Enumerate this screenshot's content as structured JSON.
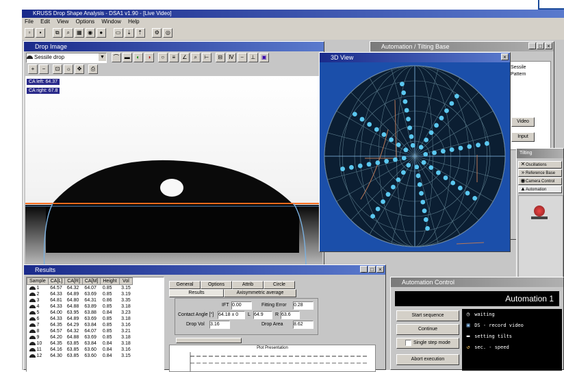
{
  "app": {
    "title": "KRUSS Drop Shape Analysis - DSA1 v1.90 - [Live Video]",
    "menu": [
      "File",
      "Edit",
      "View",
      "Options",
      "Window",
      "Help"
    ]
  },
  "image_window": {
    "title": "Drop Image",
    "method": "Sessile drop",
    "angle_left": "CA left: 64.37",
    "angle_right": "CA right: 67.8"
  },
  "polar_window": {
    "title": "3D View"
  },
  "right_window": {
    "title": "Automation / Tilting Base",
    "items": [
      "Oscillations",
      "Reference Base",
      "Camera Control",
      "Automation"
    ],
    "side_texts": [
      "Sessile",
      "Pattern",
      "Video",
      "Input"
    ]
  },
  "results_window": {
    "title": "Results",
    "columns": [
      "Sample",
      "CA[L]",
      "CA[R]",
      "CA[M]",
      "Height",
      "Vol"
    ],
    "rows": [
      [
        "1",
        "64.57",
        "64.32",
        "64.07",
        "0.85",
        "3.15"
      ],
      [
        "2",
        "64.33",
        "64.89",
        "63.69",
        "0.85",
        "3.19"
      ],
      [
        "3",
        "64.81",
        "64.80",
        "64.31",
        "0.86",
        "3.35"
      ],
      [
        "4",
        "64.33",
        "64.88",
        "63.89",
        "0.85",
        "3.18"
      ],
      [
        "5",
        "64.00",
        "63.95",
        "63.88",
        "0.84",
        "3.23"
      ],
      [
        "6",
        "64.33",
        "64.89",
        "63.69",
        "0.85",
        "3.18"
      ],
      [
        "7",
        "64.35",
        "64.29",
        "63.84",
        "0.85",
        "3.16"
      ],
      [
        "8",
        "64.57",
        "64.32",
        "64.07",
        "0.85",
        "3.21"
      ],
      [
        "9",
        "64.20",
        "64.88",
        "63.69",
        "0.85",
        "3.18"
      ],
      [
        "10",
        "64.35",
        "63.85",
        "63.84",
        "0.84",
        "3.18"
      ],
      [
        "11",
        "64.16",
        "63.85",
        "63.60",
        "0.84",
        "3.16"
      ],
      [
        "12",
        "64.30",
        "63.85",
        "63.60",
        "0.84",
        "3.15"
      ]
    ],
    "tabs_top": [
      "General",
      "Options",
      "Attrib",
      "Circle"
    ],
    "tabs_bottom": [
      "Results",
      "Axisymmetric average"
    ],
    "fields": {
      "ift_label": "IFT",
      "ift_value": "0.00",
      "fitting_error_label": "Fitting Error",
      "fitting_error_value": "0.28",
      "contact_angle_label": "Contact Angle [°]",
      "contact_angle_value": "64.18 ± 0",
      "l_label": "L",
      "l_value": "64.9",
      "r_label": "R",
      "r_value": "63.6",
      "drop_vol_label": "Drop Vol",
      "drop_vol_value": "3.16",
      "drop_area_label": "Drop Area",
      "drop_area_value": "8.62"
    },
    "plot_title": "Plot Presentation"
  },
  "automation_window": {
    "title": "Automation Control",
    "header": "Automation 1",
    "buttons": [
      "Start sequence",
      "Continue",
      "Single step mode",
      "Abort execution"
    ],
    "list": [
      {
        "icon": "clock-icon",
        "text": "waiting"
      },
      {
        "icon": "video-icon",
        "text": "DS - record video"
      },
      {
        "icon": "tilt-icon",
        "text": "setting tilts"
      },
      {
        "icon": "loop-icon",
        "text": "sec. - speed"
      }
    ]
  },
  "colors": {
    "title_active": "#1a2a8a",
    "polar_bg": "#0b1e32",
    "dots": "#5bc8f0",
    "baseline": "#ff6a1a"
  }
}
